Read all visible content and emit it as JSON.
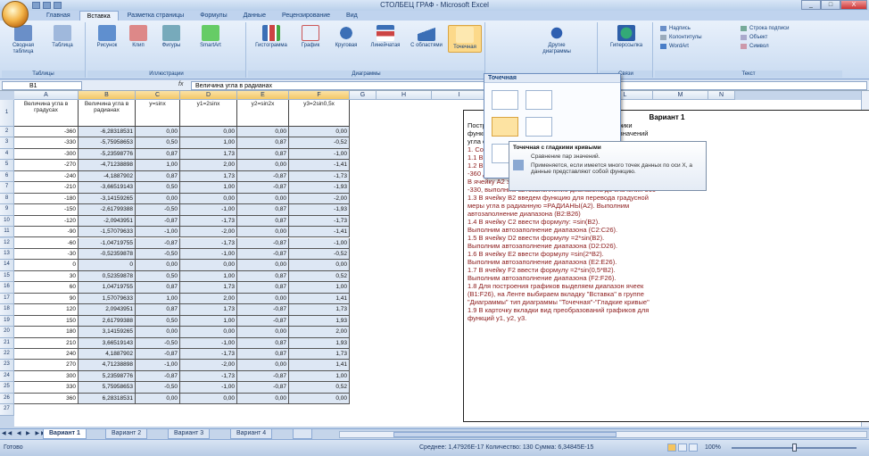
{
  "window": {
    "title": "СТОЛБЕЦ ГРАФ - Microsoft Excel",
    "qat": [
      "save",
      "undo",
      "redo"
    ],
    "controls": [
      "_",
      "□",
      "X"
    ]
  },
  "tabs": [
    "Главная",
    "Вставка",
    "Разметка страницы",
    "Формулы",
    "Данные",
    "Рецензирование",
    "Вид"
  ],
  "ribbon": {
    "groups": [
      "Таблицы",
      "Иллюстрации",
      "Диаграммы",
      "Связи",
      "Текст"
    ],
    "buttons": [
      "Сводная таблица",
      "Таблица",
      "Рисунок",
      "Клип",
      "Фигуры",
      "SmartArt",
      "Гистограмма",
      "График",
      "Круговая",
      "Линейчатая",
      "С областями",
      "Точечная",
      "Другие диаграммы",
      "Гиперссылка"
    ],
    "text_items": [
      "Надпись",
      "Колонтитулы",
      "WordArt",
      "Строка подписи",
      "Объект",
      "Символ"
    ]
  },
  "formula_bar": {
    "name_box": "B1",
    "fx": "fx",
    "content": "Величина угла в радианах"
  },
  "columns": [
    "A",
    "B",
    "C",
    "D",
    "E",
    "F",
    "G",
    "H",
    "I",
    "J",
    "K",
    "L",
    "M",
    "N"
  ],
  "headers": [
    "Величина угла в градусах",
    "Величина угла в радианах",
    "y=sinx",
    "y1=2sinx",
    "y2=sin2x",
    "y3=2sin0,5x"
  ],
  "rows": [
    [
      "-360",
      "-6,28318531",
      "0,00",
      "0,00",
      "0,00",
      "0,00"
    ],
    [
      "-330",
      "-5,75958653",
      "0,50",
      "1,00",
      "0,87",
      "-0,52"
    ],
    [
      "-300",
      "-5,23598776",
      "0,87",
      "1,73",
      "0,87",
      "-1,00"
    ],
    [
      "-270",
      "-4,71238898",
      "1,00",
      "2,00",
      "0,00",
      "-1,41"
    ],
    [
      "-240",
      "-4,1887902",
      "0,87",
      "1,73",
      "-0,87",
      "-1,73"
    ],
    [
      "-210",
      "-3,66519143",
      "0,50",
      "1,00",
      "-0,87",
      "-1,93"
    ],
    [
      "-180",
      "-3,14159265",
      "0,00",
      "0,00",
      "0,00",
      "-2,00"
    ],
    [
      "-150",
      "-2,61799388",
      "-0,50",
      "-1,00",
      "0,87",
      "-1,93"
    ],
    [
      "-120",
      "-2,0943951",
      "-0,87",
      "-1,73",
      "0,87",
      "-1,73"
    ],
    [
      "-90",
      "-1,57079633",
      "-1,00",
      "-2,00",
      "0,00",
      "-1,41"
    ],
    [
      "-60",
      "-1,04719755",
      "-0,87",
      "-1,73",
      "-0,87",
      "-1,00"
    ],
    [
      "-30",
      "-0,52359878",
      "-0,50",
      "-1,00",
      "-0,87",
      "-0,52"
    ],
    [
      "0",
      "0",
      "0,00",
      "0,00",
      "0,00",
      "0,00"
    ],
    [
      "30",
      "0,52359878",
      "0,50",
      "1,00",
      "0,87",
      "0,52"
    ],
    [
      "60",
      "1,04719755",
      "0,87",
      "1,73",
      "0,87",
      "1,00"
    ],
    [
      "90",
      "1,57079633",
      "1,00",
      "2,00",
      "0,00",
      "1,41"
    ],
    [
      "120",
      "2,0943951",
      "0,87",
      "1,73",
      "-0,87",
      "1,73"
    ],
    [
      "150",
      "2,61799388",
      "0,50",
      "1,00",
      "-0,87",
      "1,93"
    ],
    [
      "180",
      "3,14159265",
      "0,00",
      "0,00",
      "0,00",
      "2,00"
    ],
    [
      "210",
      "3,66519143",
      "-0,50",
      "-1,00",
      "0,87",
      "1,93"
    ],
    [
      "240",
      "4,1887902",
      "-0,87",
      "-1,73",
      "0,87",
      "1,73"
    ],
    [
      "270",
      "4,71238898",
      "-1,00",
      "-2,00",
      "0,00",
      "1,41"
    ],
    [
      "300",
      "5,23598776",
      "-0,87",
      "-1,73",
      "-0,87",
      "1,00"
    ],
    [
      "330",
      "5,75958653",
      "-0,50",
      "-1,00",
      "-0,87",
      "0,52"
    ],
    [
      "360",
      "6,28318531",
      "0,00",
      "0,00",
      "0,00",
      "0,00"
    ]
  ],
  "row_numbers": [
    "1",
    "2",
    "3",
    "4",
    "5",
    "6",
    "7",
    "8",
    "9",
    "10",
    "11",
    "12",
    "13",
    "14",
    "15",
    "16",
    "17",
    "18",
    "19",
    "20",
    "21",
    "22",
    "23",
    "24",
    "25",
    "26",
    "27"
  ],
  "textbox": {
    "title": "Вариант 1",
    "lines": [
      "Построить в одной координатной плоскости графики",
      "функций y=sinx, y=2sinx, y=sin2x, y=2sin0,5x для значений",
      "угла от -360 до 360 с шагом 30.",
      "1. Создание таблицы значений заданных функций",
      "1.1 В ячейки A1:F1 ввести названия заголовки столбцов.",
      "1.2 В ячейке A2 ввести значение величины углов от",
      "-360 до 360 с шагом 30.",
      "В ячейку A2 значение -360, в ячейку A3 значение",
      "-330, выполним автозаполнение диапазона до значения 360",
      "1.3 В ячейку B2 введем функцию для перевода градусной",
      "меры угла в радианную =РАДИАНЫ(A2). Выполним",
      "автозаполнение диапазона (B2:B26)",
      "1.4 В ячейку C2 ввести формулу: =sin(B2).",
      "Выполним автозаполнение диапазона (C2:C26).",
      "1.5 В ячейку D2 ввести формулу =2*sin(B2).",
      "Выполним автозаполнение диапазона (D2:D26).",
      "1.6 В ячейку E2 ввести формулу =sin(2*B2).",
      "Выполним автозаполнение диапазона (E2:E26).",
      "1.7 В ячейку F2 ввести формулу =2*sin(0,5*B2).",
      "Выполним автозаполнение диапазона (F2:F26).",
      "1.8 Для построения графиков выделяем диапазон ячеек",
      "(B1:F26), на Ленте выбираем вкладку \"Вставка\" в группе",
      "\"Диаграммы\" тип диаграммы \"Точечная\"-\"Гладкие кривые\"",
      "1.9 В карточку вкладки вид преобразований графиков для",
      "функций y1, y2, y3."
    ]
  },
  "dropdown": {
    "title": "Точечная"
  },
  "tooltip": {
    "title": "Точечная с гладкими кривыми",
    "line1": "Сравнение пар значений.",
    "line2": "Применяется, если имеется много точек данных по оси X, а данные представляют собой функцию."
  },
  "sheets": [
    "Вариант 1",
    "Вариант 2",
    "Вариант 3",
    "Вариант 4"
  ],
  "status": {
    "ready": "Готово",
    "stats": "Среднее: 1,47926E-17   Количество: 130   Сумма: 6,34845E-15",
    "zoom": "100%"
  }
}
